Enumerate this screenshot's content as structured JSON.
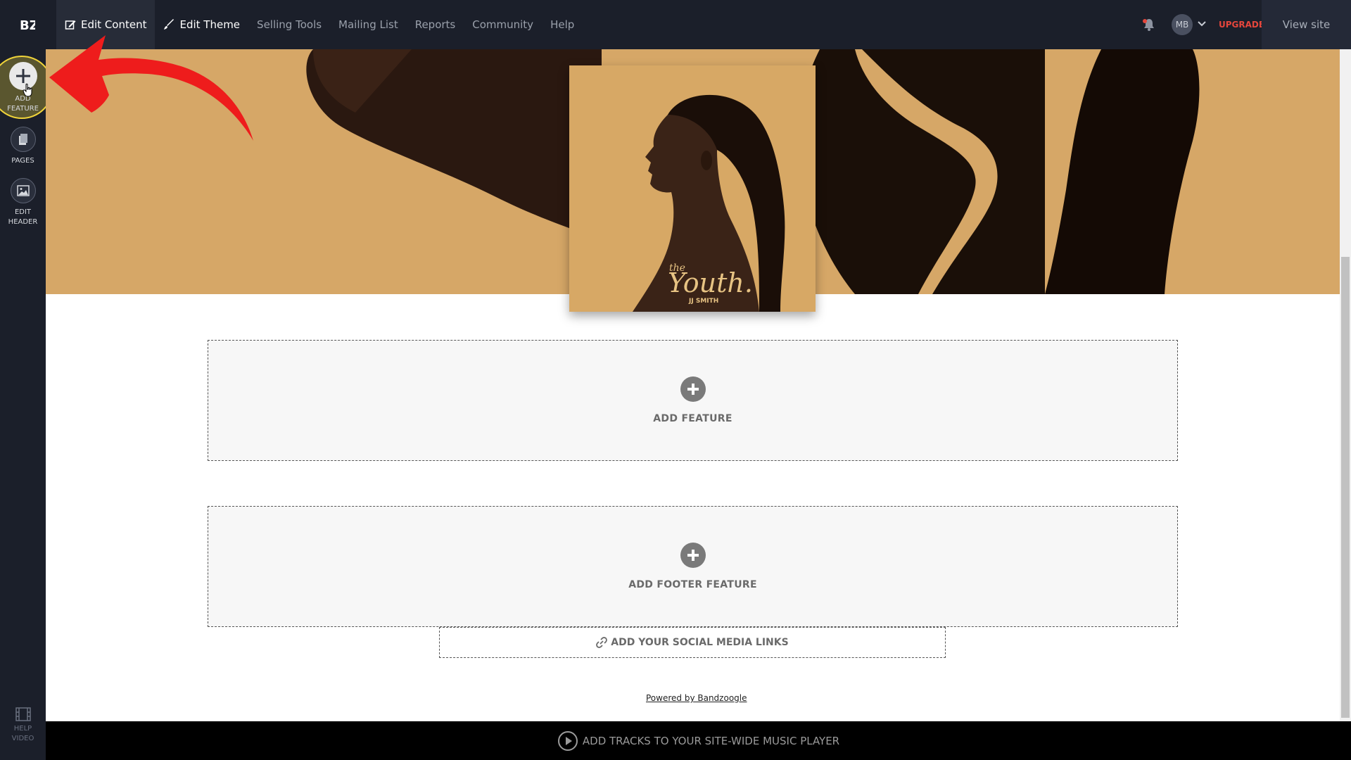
{
  "topbar": {
    "logo_text": "BZ",
    "nav": [
      {
        "label": "Edit Content",
        "icon": "edit-icon"
      },
      {
        "label": "Edit Theme",
        "icon": "brush-icon"
      },
      {
        "label": "Selling Tools"
      },
      {
        "label": "Mailing List"
      },
      {
        "label": "Reports"
      },
      {
        "label": "Community"
      },
      {
        "label": "Help"
      }
    ],
    "avatar_initials": "MB",
    "upgrade_label": "UPGRADE",
    "view_site_label": "View site"
  },
  "sidebar": {
    "add_feature": {
      "line1": "ADD",
      "line2": "FEATURE"
    },
    "pages": {
      "label": "PAGES"
    },
    "edit_header": {
      "line1": "EDIT",
      "line2": "HEADER"
    },
    "help_video": {
      "line1": "HELP",
      "line2": "VIDEO"
    }
  },
  "main": {
    "album": {
      "title_small": "the",
      "title": "Youth.",
      "artist": "JJ SMITH"
    },
    "add_feature_label": "ADD FEATURE",
    "add_footer_label": "ADD FOOTER FEATURE",
    "social_label": "ADD YOUR SOCIAL MEDIA LINKS",
    "powered_label": "Powered by Bandzoogle"
  },
  "player": {
    "label": "ADD TRACKS TO YOUR SITE-WIDE MUSIC PLAYER"
  },
  "colors": {
    "topbar": "#1b1f2a",
    "hero": "#d6a767",
    "upgrade": "#e5463c",
    "arrow": "#ee1c1c"
  }
}
